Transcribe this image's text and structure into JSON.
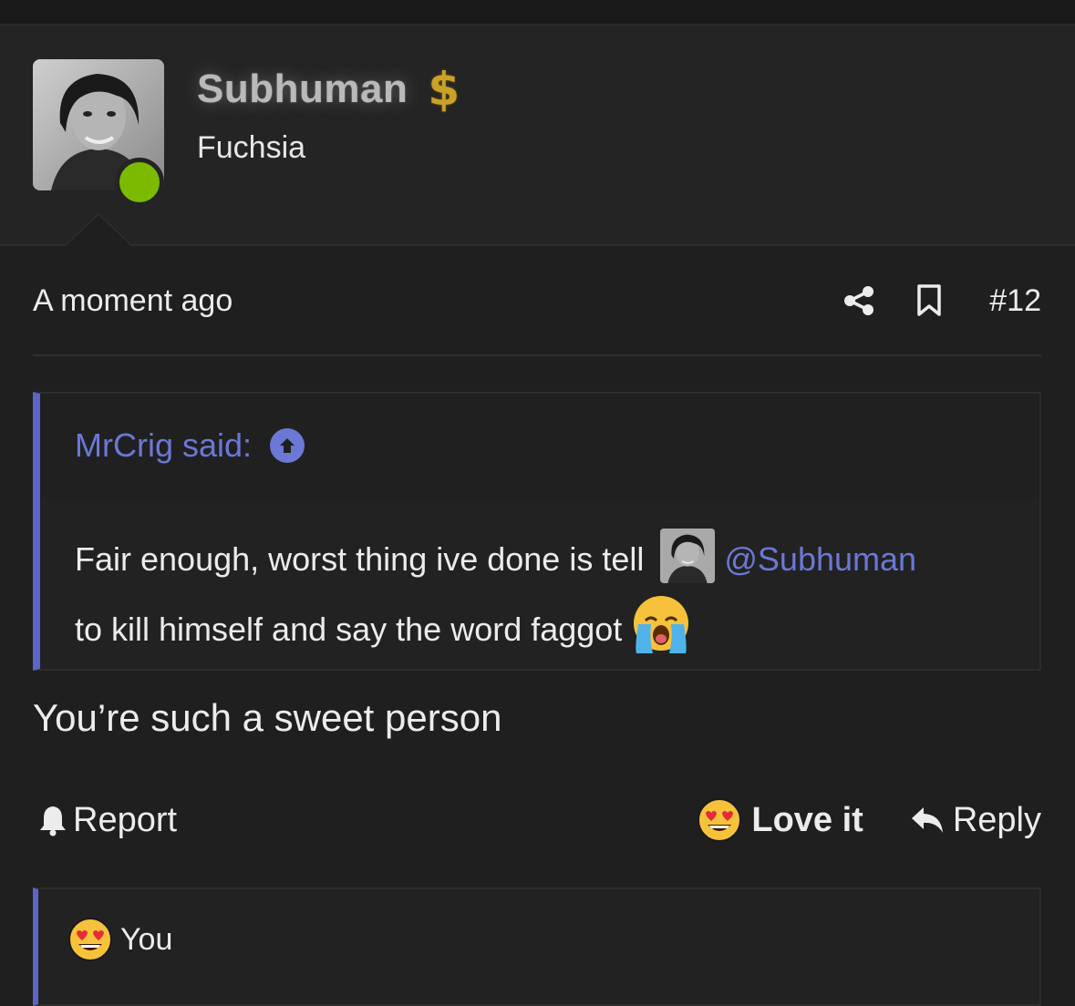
{
  "user": {
    "name": "Subhuman",
    "badge_symbol": "$",
    "title": "Fuchsia",
    "online": true
  },
  "post": {
    "timestamp": "A moment ago",
    "number": "#12",
    "message": "You’re such a sweet person"
  },
  "quote": {
    "author_label": "MrCrig said:",
    "text_before": "Fair enough, worst thing ive done is tell ",
    "mention": "@Subhuman",
    "text_after": "to kill himself and say the word faggot"
  },
  "actions": {
    "report": "Report",
    "love": "Love it",
    "reply": "Reply"
  },
  "reactions": {
    "label": "You"
  },
  "colors": {
    "accent": "#6b78d6",
    "background": "#1f1f1f",
    "header_bg": "#242424",
    "online": "#7cba00",
    "badge": "#c9a227"
  }
}
